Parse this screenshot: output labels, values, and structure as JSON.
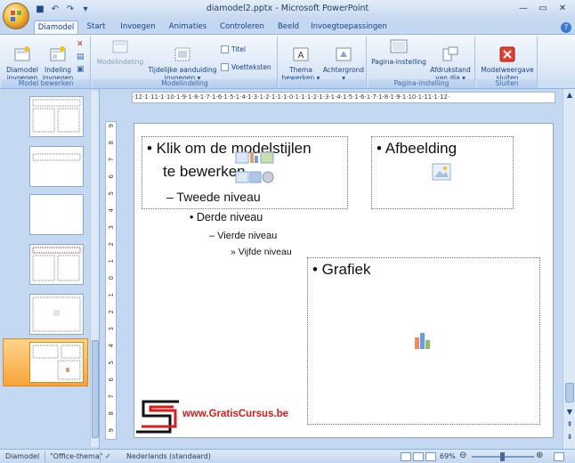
{
  "titlebar": {
    "title": "diamodel2.pptx - Microsoft PowerPoint",
    "qat_undo": "↶",
    "qat_redo": "↷",
    "qat_save": "■",
    "qat_more": "▾",
    "minimize": "—",
    "maximize": "▭",
    "close": "✕"
  },
  "tabs": [
    "Diamodel",
    "Start",
    "Invoegen",
    "Animaties",
    "Controleren",
    "Beeld",
    "Invoegtoepassingen"
  ],
  "ribbon": {
    "group_model_bewerken": {
      "label": "Model bewerken",
      "btn_diamodel": "Diamodel\ninvoegen",
      "btn_indeling": "Indeling\ninvoegen"
    },
    "group_modelindeling": {
      "label": "Modelindeling",
      "btn_modelindeling": "Modelindeling",
      "btn_tijdelijke": "Tijdelijke aanduiding\ninvoegen ▾",
      "cb_titel": "Titel",
      "cb_voetteksten": "Voetteksten"
    },
    "group_thema": {
      "btn_thema": "Thema\nbewerken ▾",
      "btn_achtergrond": "Achtergrond\n▾"
    },
    "group_pagina": {
      "label": "Pagina-instelling",
      "btn_pagina": "Pagina-instelling",
      "btn_afdrukstand": "Afdrukstand\nvan dia ▾"
    },
    "group_sluiten": {
      "label": "Sluiten",
      "btn_sluiten": "Modelweergave\nsluiten"
    }
  },
  "ruler": {
    "h": "·12·1·11·1·10·1·9·1·8·1·7·1·6·1·5·1·4·1·3·1·2·1·1·1·0·1·1·1·2·1·3·1·4·1·5·1·6·1·7·1·8·1·9·1·10·1·11·1·12·",
    "v": [
      "9",
      "8",
      "7",
      "6",
      "5",
      "4",
      "3",
      "2",
      "1",
      "0",
      "1",
      "2",
      "3",
      "4",
      "5",
      "6",
      "7",
      "8",
      "9"
    ]
  },
  "slide": {
    "level1_line1": "• Klik om de modelstijlen",
    "level1_line2": "te bewerken",
    "level2": "– Tweede niveau",
    "level3": "• Derde niveau",
    "level4": "– Vierde niveau",
    "level5": "» Vijfde niveau",
    "afbeelding": "• Afbeelding",
    "grafiek": "• Grafiek",
    "watermark": "www.GratisCursus.be"
  },
  "statusbar": {
    "view": "Diamodel",
    "theme": "\"Office-thema\"",
    "language": "Nederlands (standaard)",
    "zoom": "69%",
    "zoom_minus": "⊖",
    "zoom_plus": "⊕"
  },
  "colors": {
    "ribbon_text": "#15428b",
    "selected_thumb": "#f8a43c",
    "watermark": "#d81b1b"
  }
}
